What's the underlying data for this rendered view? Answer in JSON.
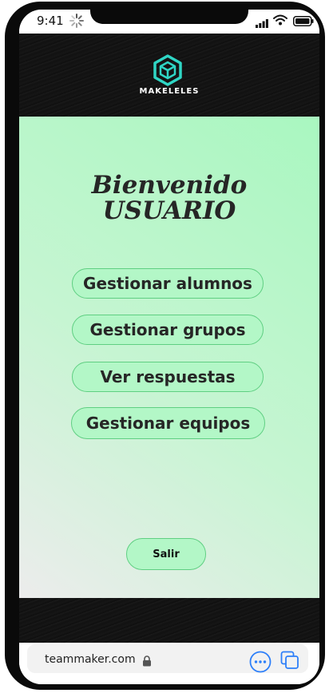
{
  "status_bar": {
    "time": "9:41",
    "icons": [
      "loading-spinner-icon",
      "signal-icon",
      "wifi-icon",
      "battery-icon"
    ]
  },
  "header": {
    "brand": "MAKELELES",
    "logo_icon": "cube-logo-icon"
  },
  "main": {
    "welcome_line1": "Bienvenido",
    "welcome_line2": "USUARIO",
    "menu": [
      {
        "label": "Gestionar alumnos"
      },
      {
        "label": "Gestionar grupos"
      },
      {
        "label": "Ver respuestas"
      },
      {
        "label": "Gestionar equipos"
      }
    ],
    "logout_label": "Salir"
  },
  "browser": {
    "url": "teammaker.com",
    "icons": [
      "lock-icon",
      "more-options-icon",
      "tabs-icon"
    ]
  },
  "colors": {
    "accent_green": "#b3f7c7",
    "button_border": "#5fcf82",
    "logo_teal": "#2fd6c5",
    "browser_blue": "#2d7ff9"
  }
}
